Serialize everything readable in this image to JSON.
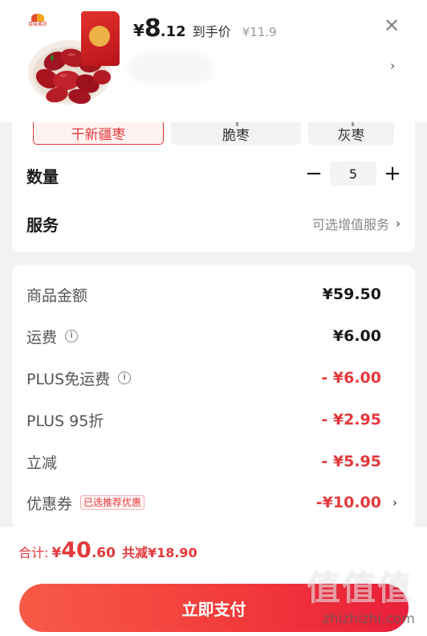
{
  "product": {
    "brand_logo_text": "百味美农",
    "price_symbol": "¥",
    "price_int": "8",
    "price_dec": ".12",
    "price_tag": "到手价",
    "original_price": "¥11.9"
  },
  "header": {
    "close_icon": "✕",
    "chevron": "›"
  },
  "variants": [
    {
      "label": "干新疆枣",
      "selected": true
    },
    {
      "label": "脆枣",
      "selected": false
    },
    {
      "label": "灰枣",
      "selected": false
    }
  ],
  "quantity": {
    "label": "数量",
    "minus": "−",
    "value": "5",
    "plus": "+"
  },
  "service": {
    "label": "服务",
    "link_text": "可选增值服务",
    "chevron": "›"
  },
  "price_details": {
    "rows": [
      {
        "label": "商品金额",
        "value": "¥59.50",
        "info": false,
        "red": false
      },
      {
        "label": "运费",
        "value": "¥6.00",
        "info": true,
        "red": false
      },
      {
        "label": "PLUS免运费",
        "value": "- ¥6.00",
        "info": true,
        "red": true
      },
      {
        "label": "PLUS 95折",
        "value": "- ¥2.95",
        "info": false,
        "red": true
      },
      {
        "label": "立减",
        "value": "- ¥5.95",
        "info": false,
        "red": true
      }
    ],
    "coupon": {
      "label": "优惠券",
      "badge": "已选推荐优惠",
      "value": "-¥10.00",
      "chevron": "›"
    }
  },
  "footer": {
    "total_label": "合计:",
    "total_sym": "¥",
    "total_int": "40",
    "total_dec": ".60",
    "savings": "共减¥18.90",
    "pay_button": "立即支付"
  },
  "watermark": {
    "glyphs": "值值值",
    "url": "zhizhizhi.com"
  },
  "colors": {
    "accent_red": "#e4393c",
    "page_bg": "#f2f2f4"
  }
}
